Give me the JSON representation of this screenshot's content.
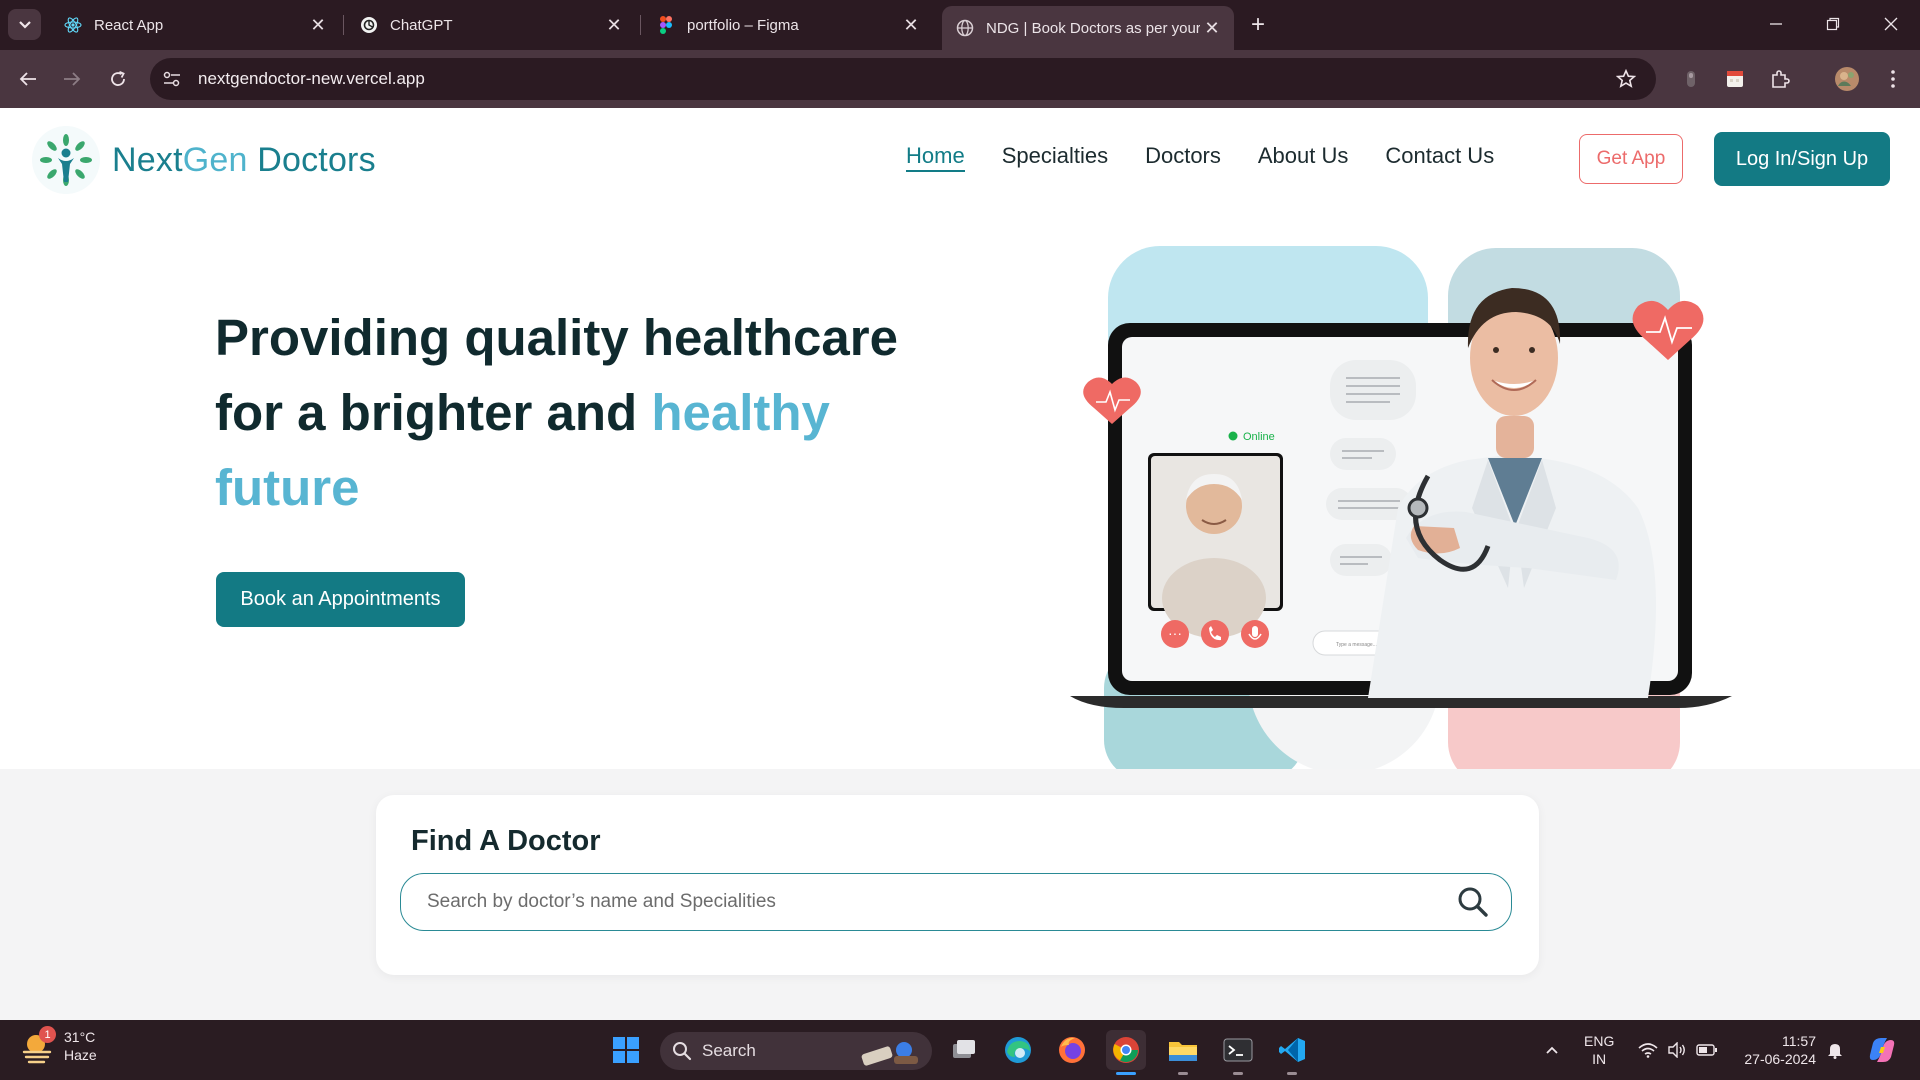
{
  "browser": {
    "tabs": [
      {
        "title": "React App"
      },
      {
        "title": "ChatGPT"
      },
      {
        "title": "portfolio – Figma"
      },
      {
        "title": "NDG | Book Doctors as per your"
      }
    ],
    "active_tab": 3,
    "url": "nextgendoctor-new.vercel.app"
  },
  "site": {
    "logo": {
      "part1": "Next",
      "part2": "Gen",
      "part3": " Doctors"
    },
    "nav": [
      "Home",
      "Specialties",
      "Doctors",
      "About Us",
      "Contact Us"
    ],
    "get_app": "Get App",
    "login": "Log In/Sign Up",
    "hero": {
      "line1": "Providing quality healthcare",
      "line2_a": "for a brighter and ",
      "line2_b": "healthy",
      "line3": "future",
      "cta": "Book an Appointments"
    },
    "illustration": {
      "online_label": "Online",
      "message_placeholder": "Type a message..."
    },
    "find": {
      "title": "Find A Doctor",
      "placeholder": "Search by doctor’s name and Specialities"
    }
  },
  "taskbar": {
    "weather": {
      "temp": "31°C",
      "condition": "Haze",
      "badge": "1"
    },
    "search_label": "Search",
    "lang": {
      "line1": "ENG",
      "line2": "IN"
    },
    "time": "11:57",
    "date": "27-06-2024"
  },
  "colors": {
    "accent_teal": "#137a84",
    "highlight_blue": "#58b5d2",
    "coral": "#ec6b6b",
    "chrome_dark": "#2b1a22"
  }
}
